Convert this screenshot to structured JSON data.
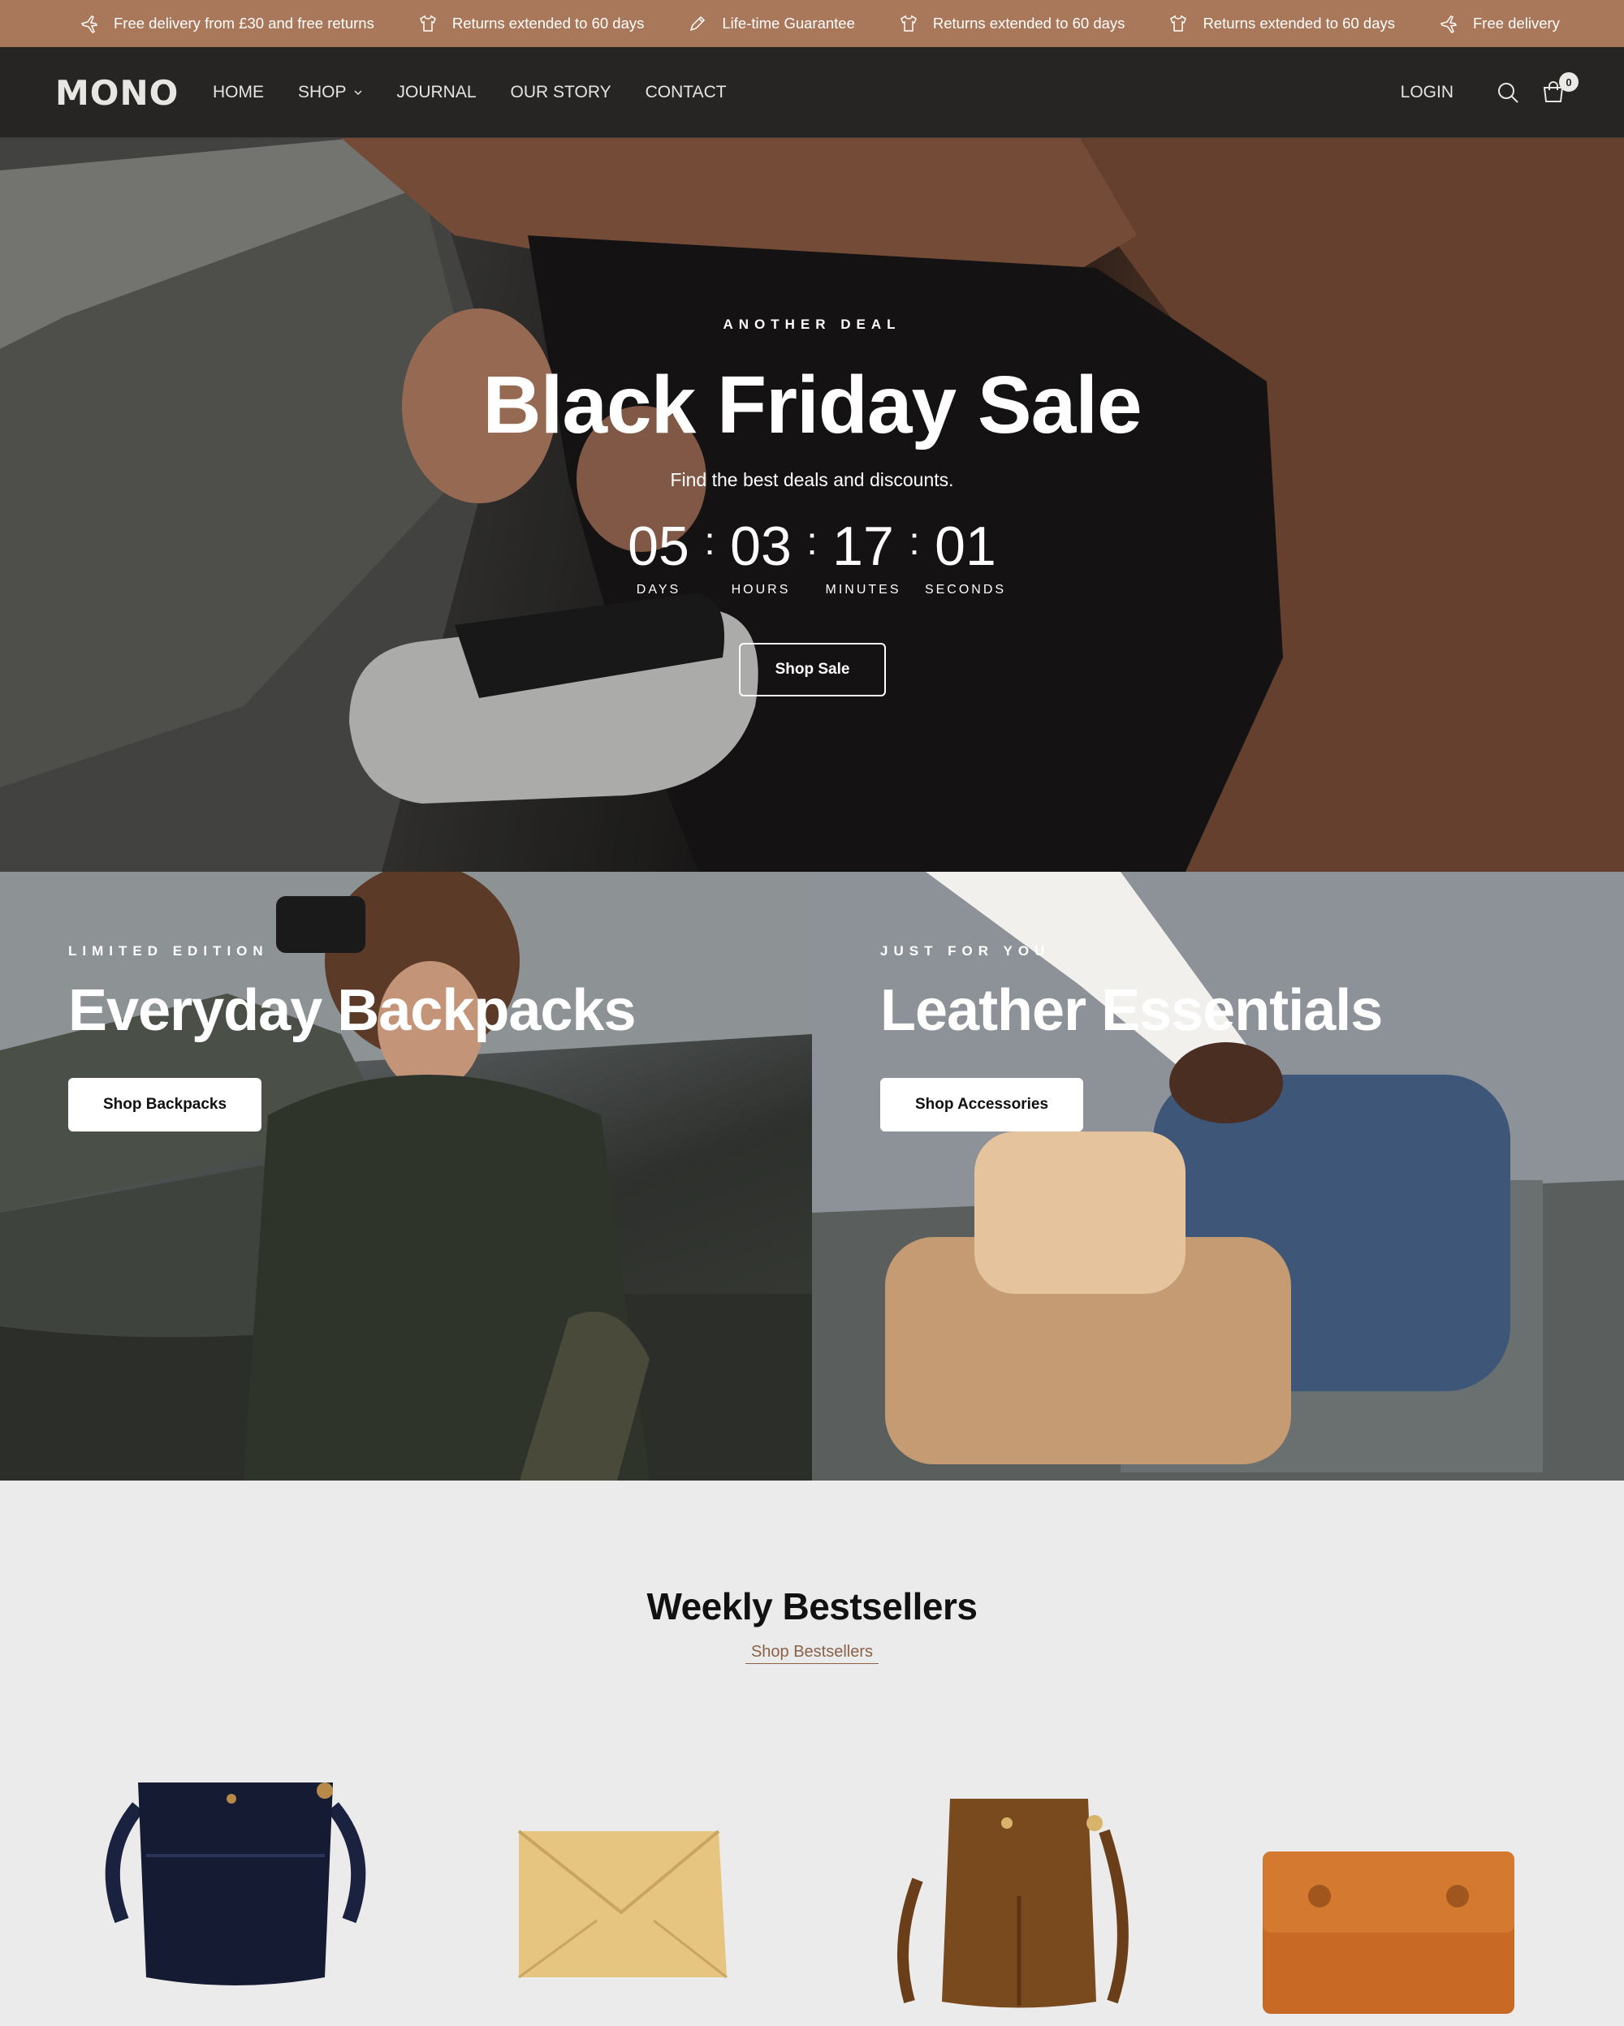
{
  "announcement": {
    "items": [
      {
        "icon": "plane-icon",
        "text": "Free delivery from £30 and free returns"
      },
      {
        "icon": "shirt-icon",
        "text": "Returns extended to 60 days"
      },
      {
        "icon": "pen-icon",
        "text": "Life-time Guarantee"
      },
      {
        "icon": "shirt-icon",
        "text": "Returns extended to 60 days"
      },
      {
        "icon": "shirt-icon",
        "text": "Returns extended to 60 days"
      },
      {
        "icon": "plane-icon",
        "text": "Free delivery"
      }
    ],
    "background": "#a9785a"
  },
  "header": {
    "logo": "MONO",
    "nav": [
      "HOME",
      "SHOP",
      "JOURNAL",
      "OUR STORY",
      "CONTACT"
    ],
    "login": "LOGIN",
    "cart_count": "0",
    "background": "#262523"
  },
  "hero": {
    "kicker": "ANOTHER DEAL",
    "title": "Black Friday Sale",
    "subtitle": "Find the best deals and discounts.",
    "countdown": {
      "days": "05",
      "hours": "03",
      "minutes": "17",
      "seconds": "01",
      "days_label": "DAYS",
      "hours_label": "HOURS",
      "minutes_label": "MINUTES",
      "seconds_label": "SECONDS",
      "separator": ":"
    },
    "button": "Shop Sale"
  },
  "promos": [
    {
      "kicker": "LIMITED EDITION",
      "title": "Everyday Backpacks",
      "button": "Shop Backpacks"
    },
    {
      "kicker": "JUST FOR YOU",
      "title": "Leather Essentials",
      "button": "Shop Accessories"
    }
  ],
  "bestsellers": {
    "title": "Weekly Bestsellers",
    "link": "Shop Bestsellers",
    "products": [
      {
        "name": "navy-croc-bucket-bag",
        "color": "#141b33"
      },
      {
        "name": "yellow-envelope-pouch",
        "color": "#e5c57f"
      },
      {
        "name": "brown-suede-bucket-bag",
        "color": "#7a4a1f"
      },
      {
        "name": "orange-leather-satchel",
        "color": "#c86a25"
      }
    ]
  },
  "colors": {
    "accent": "#a9785a",
    "link": "#8a6148"
  }
}
